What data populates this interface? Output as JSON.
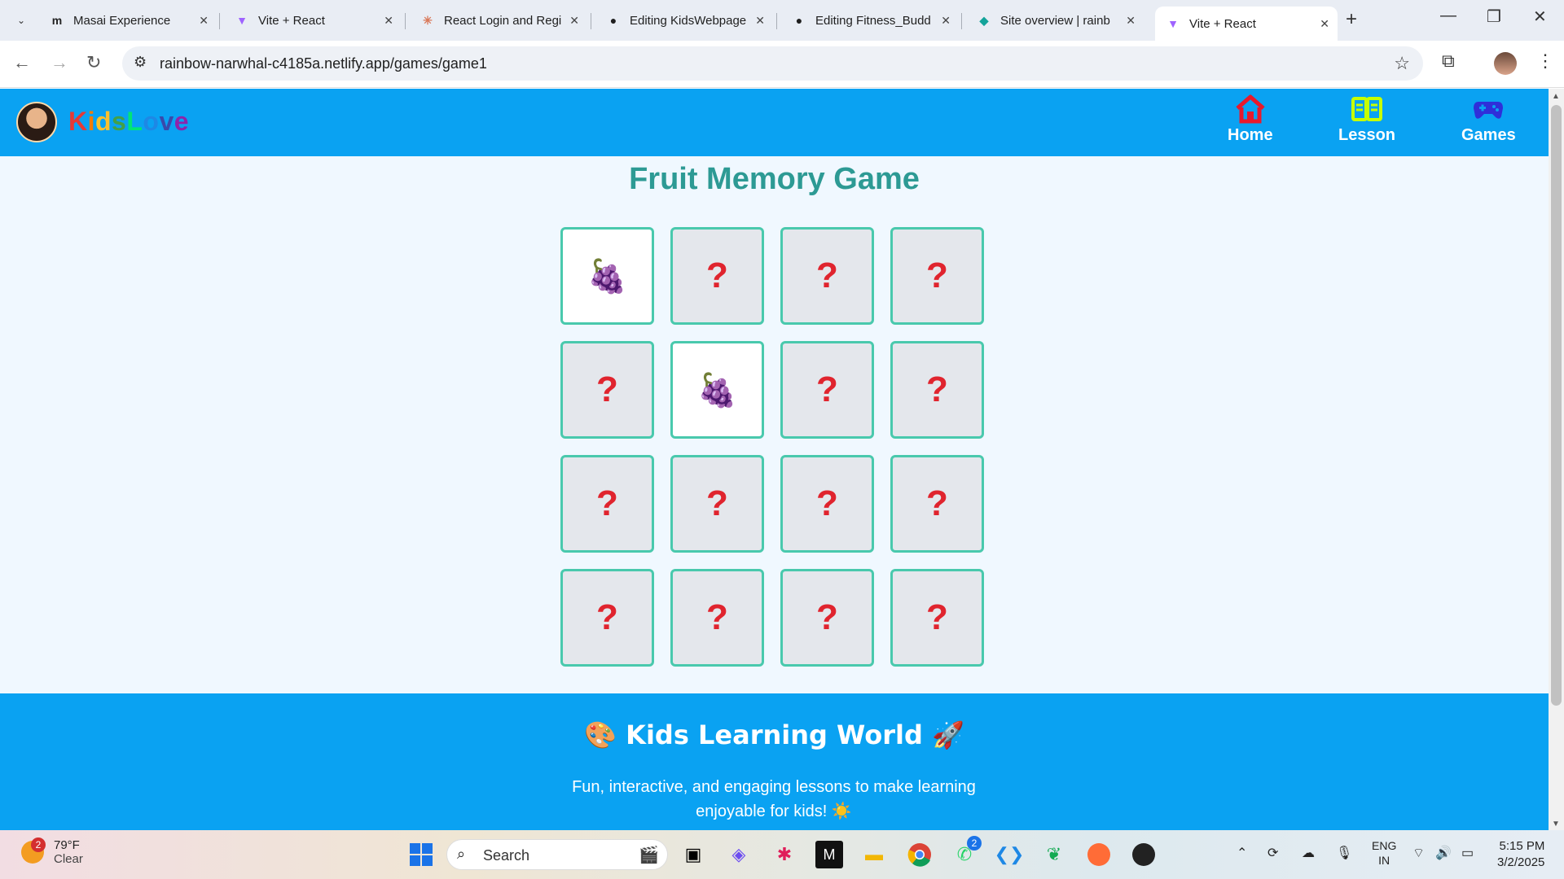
{
  "browser": {
    "tabs": [
      {
        "title": "Masai Experience",
        "favicon": "m",
        "favicon_color": "#222222"
      },
      {
        "title": "Vite + React",
        "favicon": "vite-logo",
        "favicon_color": "#9f63ff"
      },
      {
        "title": "React Login and Regi",
        "favicon": "claude-asterisk",
        "favicon_color": "#d97757"
      },
      {
        "title": "Editing KidsWebpage",
        "favicon": "github-logo",
        "favicon_color": "#1f1f1f"
      },
      {
        "title": "Editing Fitness_Budd",
        "favicon": "github-logo",
        "favicon_color": "#1f1f1f"
      },
      {
        "title": "Site overview | rainb",
        "favicon": "netlify-logo",
        "favicon_color": "#13a39a"
      },
      {
        "title": "Vite + React",
        "favicon": "vite-logo",
        "favicon_color": "#9f63ff",
        "active": true
      }
    ],
    "url": "rainbow-narwhal-c4185a.netlify.app/games/game1"
  },
  "site": {
    "brand": {
      "letters": [
        "K",
        "i",
        "d",
        "s",
        "L",
        "o",
        "v",
        "e"
      ],
      "colors": [
        "#e53935",
        "#f57c00",
        "#fbc02d",
        "#43a047",
        "#00e676",
        "#1e88e5",
        "#3949ab",
        "#8e24aa"
      ]
    },
    "nav": [
      {
        "label": "Home",
        "icon": "home-icon",
        "color": "#e8192c"
      },
      {
        "label": "Lesson",
        "icon": "book-icon",
        "color": "#c6ff00"
      },
      {
        "label": "Games",
        "icon": "gamepad-icon",
        "color": "#2f2fd9"
      }
    ],
    "title": "Fruit Memory Game",
    "cards": [
      {
        "face": "🍇",
        "flipped": true
      },
      {
        "face": "?",
        "flipped": false
      },
      {
        "face": "?",
        "flipped": false
      },
      {
        "face": "?",
        "flipped": false
      },
      {
        "face": "?",
        "flipped": false
      },
      {
        "face": "🍇",
        "flipped": true
      },
      {
        "face": "?",
        "flipped": false
      },
      {
        "face": "?",
        "flipped": false
      },
      {
        "face": "?",
        "flipped": false
      },
      {
        "face": "?",
        "flipped": false
      },
      {
        "face": "?",
        "flipped": false
      },
      {
        "face": "?",
        "flipped": false
      },
      {
        "face": "?",
        "flipped": false
      },
      {
        "face": "?",
        "flipped": false
      },
      {
        "face": "?",
        "flipped": false
      },
      {
        "face": "?",
        "flipped": false
      }
    ],
    "footer": {
      "title": "🎨 Kids Learning World 🚀",
      "subtitle": "Fun, interactive, and engaging lessons to make learning enjoyable for kids! ☀️"
    }
  },
  "taskbar": {
    "weather": {
      "temp": "79°F",
      "condition": "Clear",
      "badge": "2"
    },
    "search_placeholder": "Search",
    "whatsapp_badge": "2",
    "lang": {
      "line1": "ENG",
      "line2": "IN"
    },
    "time": "5:15 PM",
    "date": "3/2/2025"
  }
}
